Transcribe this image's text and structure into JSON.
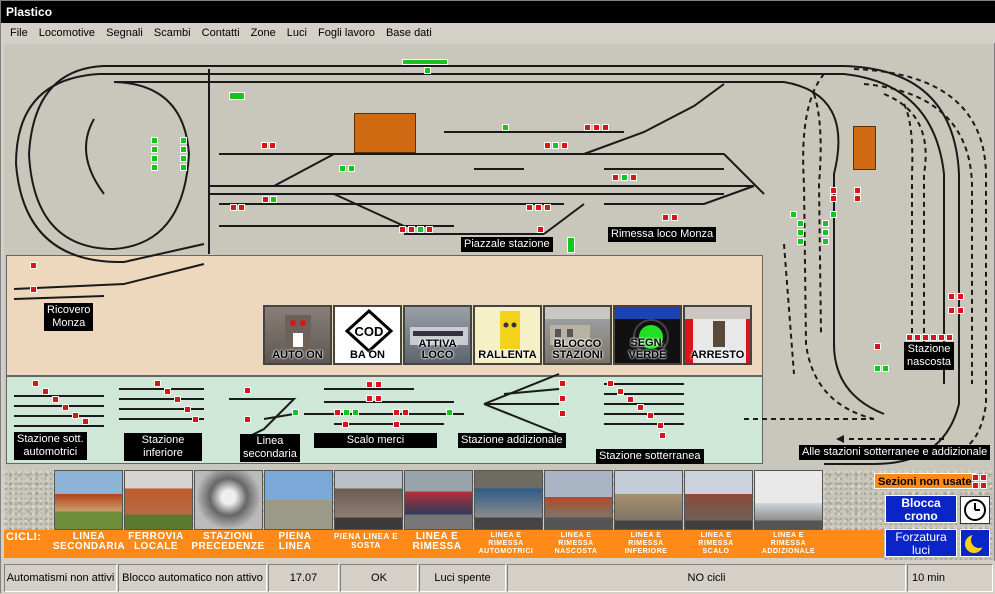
{
  "window": {
    "title": "Plastico"
  },
  "menu": [
    "File",
    "Locomotive",
    "Segnali",
    "Scambi",
    "Contatti",
    "Zone",
    "Luci",
    "Fogli lavoro",
    "Base dati"
  ],
  "labels": {
    "piazzale": "Piazzale stazione",
    "rimessa": "Rimessa loco Monza",
    "ricovero": "Ricovero\nMonza",
    "nascosta": "Stazione\nnascosta",
    "sott_auto": "Stazione sott.\nautomotrici",
    "inferiore": "Stazione\ninferiore",
    "secondaria": "Linea\nsecondaria",
    "scalo": "Scalo merci",
    "addizionale": "Stazione addizionale",
    "sotterranea": "Stazione sotterranea",
    "alle": "Alle stazioni sotterranee e addizionale",
    "sezioni": "Sezioni non usate"
  },
  "control_buttons": [
    {
      "label": "AUTO ON",
      "icon": "auto-icon"
    },
    {
      "label": "BA ON",
      "icon": "cod-icon"
    },
    {
      "label": "ATTIVA LOCO",
      "icon": "train-photo-icon"
    },
    {
      "label": "RALLENTA",
      "icon": "slow-icon"
    },
    {
      "label": "BLOCCO STAZIONI",
      "icon": "station-photo-icon"
    },
    {
      "label": "SEGN. VERDE",
      "icon": "green-signal-icon"
    },
    {
      "label": "ARRESTO",
      "icon": "stop-signal-icon"
    }
  ],
  "cicli": {
    "title": "CICLI:",
    "items": [
      "LINEA\nSECONDARIA",
      "FERROVIA\nLOCALE",
      "STAZIONI\nPRECEDENZE",
      "PIENA\nLINEA",
      "PIENA LINEA E\nSOSTA",
      "LINEA E\nRIMESSA",
      "LINEA E\nRIMESSA\nAUTOMOTRICI",
      "LINEA E\nRIMESSA\nNASCOSTA",
      "LINEA E\nRIMESSA\nINFERIORE",
      "LINEA E\nRIMESSA\nSCALO",
      "LINEA E\nRIMESSA\nADDIZIONALE"
    ]
  },
  "right_panel": {
    "blocca": "Blocca\ncrono",
    "forzatura": "Forzatura\nluci"
  },
  "status": {
    "automatismi": "Automatismi non attivi",
    "blocco": "Blocco automatico non attivo",
    "time": "17.07",
    "ok": "OK",
    "luci": "Luci spente",
    "cicli": "NO cicli",
    "interval": "10 min"
  },
  "colors": {
    "signal_red": "#d8151a",
    "signal_green": "#17c41d",
    "orange": "#ff8a18",
    "blue_button": "#0a24c8"
  }
}
